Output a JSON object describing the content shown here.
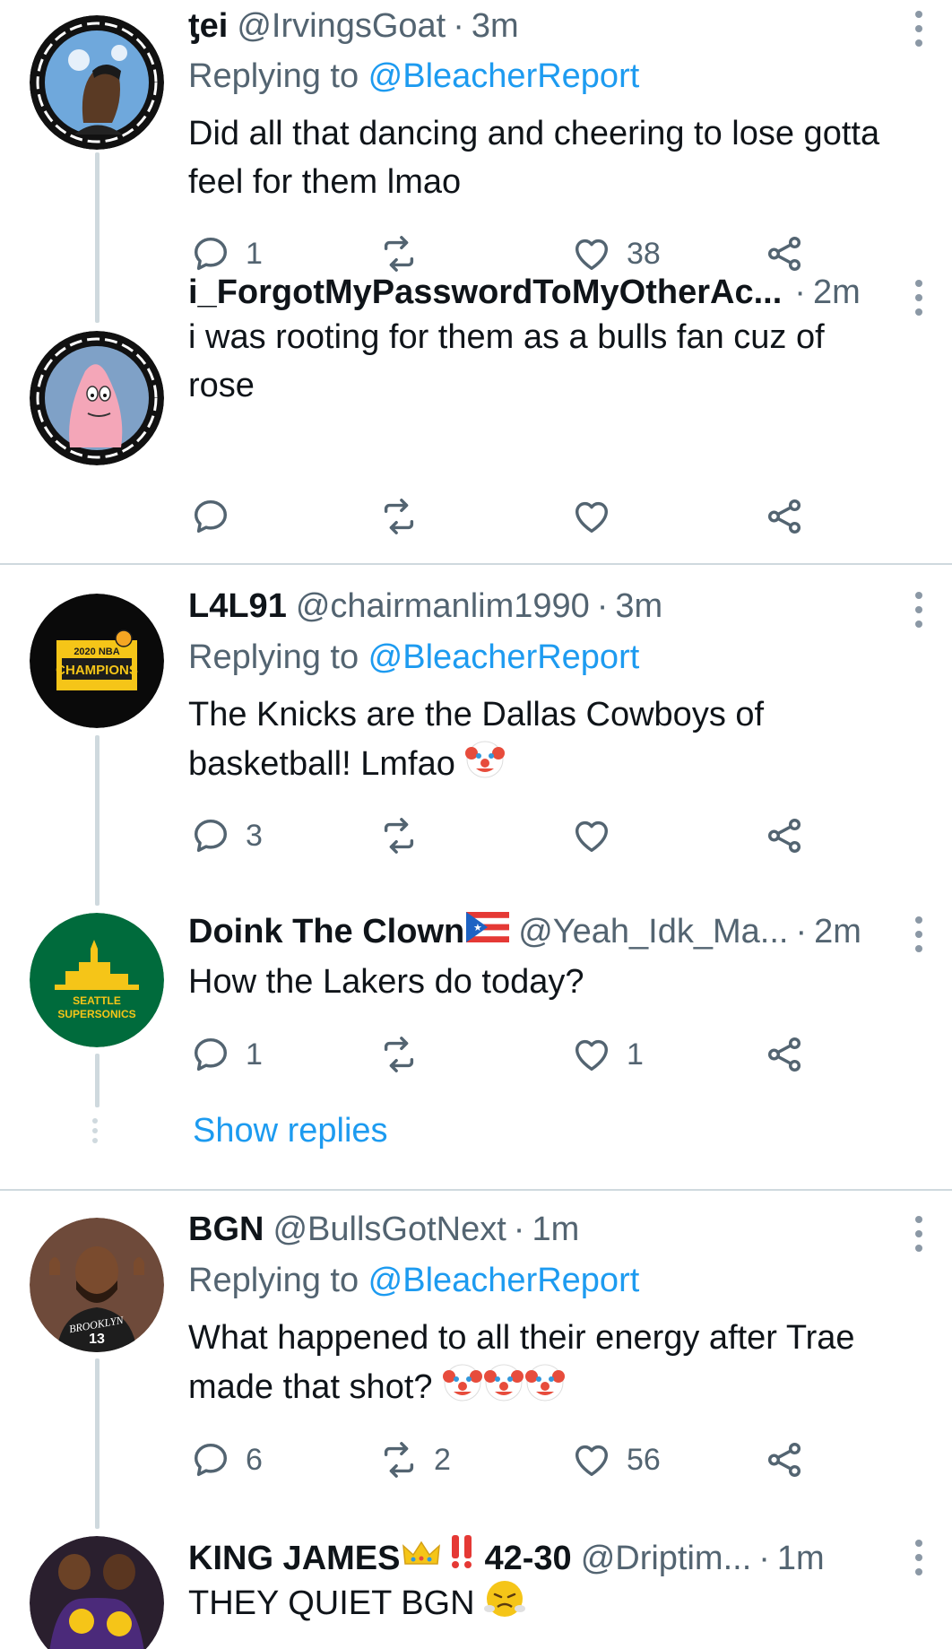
{
  "tweets": [
    {
      "name": "ƫei",
      "handle": "@IrvingsGoat",
      "time": "3m",
      "replying_prefix": "Replying to ",
      "replying_to": "@BleacherReport",
      "text_1": "Did all that dancing and cheering to lose gotta",
      "text_2": "feel for them lmao",
      "reply_count": "1",
      "retweet_count": "",
      "like_count": "38"
    },
    {
      "name": "i_ForgotMyPasswordToMyOtherAc...",
      "time": "2m",
      "text_1": "i was rooting for them as a bulls fan cuz of",
      "text_2": "rose",
      "reply_count": "",
      "retweet_count": "",
      "like_count": ""
    },
    {
      "name": "L4L91",
      "handle": "@chairmanlim1990",
      "time": "3m",
      "replying_prefix": "Replying to ",
      "replying_to": "@BleacherReport",
      "text_1": "The Knicks are the Dallas Cowboys of",
      "text_2": "basketball! Lmfao",
      "reply_count": "3",
      "retweet_count": "",
      "like_count": "",
      "avatar_text_1": "2020 NBA",
      "avatar_text_2": "CHAMPIONS"
    },
    {
      "name": "Doink The Clown",
      "handle": "@Yeah_Idk_Ma...",
      "time": "2m",
      "text_1": "How the Lakers do today?",
      "reply_count": "1",
      "retweet_count": "",
      "like_count": "1",
      "avatar_text_1": "SEATTLE",
      "avatar_text_2": "SUPERSONICS"
    },
    {
      "name": "BGN",
      "handle": "@BullsGotNext",
      "time": "1m",
      "replying_prefix": "Replying to ",
      "replying_to": "@BleacherReport",
      "text_1": "What happened to all their energy after Trae",
      "text_2": "made that shot?",
      "reply_count": "6",
      "retweet_count": "2",
      "like_count": "56",
      "avatar_text_1": "BROOKLYN",
      "avatar_text_2": "13"
    },
    {
      "name": "KING JAMES",
      "name_suffix": "42-30",
      "handle": "@Driptim...",
      "time": "1m",
      "text_1": "THEY QUIET BGN"
    }
  ],
  "show_replies": "Show replies",
  "separator": "·",
  "colors": {
    "link": "#1d9bf0",
    "secondary": "#536471",
    "line": "#cfd9de"
  }
}
